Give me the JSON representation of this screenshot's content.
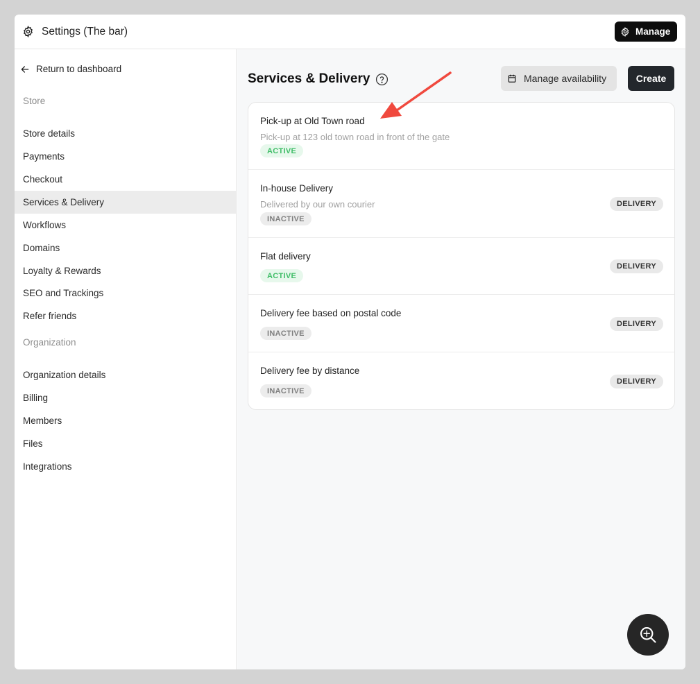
{
  "topbar": {
    "title": "Settings (The bar)",
    "manage_label": "Manage"
  },
  "sidebar": {
    "back_label": "Return to dashboard",
    "store_heading": "Store",
    "store_items": [
      "Store details",
      "Payments",
      "Checkout",
      "Services & Delivery",
      "Workflows",
      "Domains",
      "Loyalty & Rewards",
      "SEO and Trackings",
      "Refer friends"
    ],
    "org_heading": "Organization",
    "org_items": [
      "Organization details",
      "Billing",
      "Members",
      "Files",
      "Integrations"
    ]
  },
  "main": {
    "title": "Services & Delivery",
    "availability_label": "Manage availability",
    "create_label": "Create",
    "services": [
      {
        "name": "Pick-up at Old Town road",
        "description": "Pick-up at 123 old town road in front of the gate",
        "status": "ACTIVE",
        "type": ""
      },
      {
        "name": "In-house Delivery",
        "description": "Delivered by our own courier",
        "status": "INACTIVE",
        "type": "DELIVERY"
      },
      {
        "name": "Flat delivery",
        "description": "",
        "status": "ACTIVE",
        "type": "DELIVERY"
      },
      {
        "name": "Delivery fee based on postal code",
        "description": "",
        "status": "INACTIVE",
        "type": "DELIVERY"
      },
      {
        "name": "Delivery fee by distance",
        "description": "",
        "status": "INACTIVE",
        "type": "DELIVERY"
      }
    ]
  },
  "colors": {
    "annotation_arrow": "#f0493e",
    "active_text": "#3fbd67",
    "active_bg": "#e7f8ec",
    "primary_dark": "#23272c"
  }
}
